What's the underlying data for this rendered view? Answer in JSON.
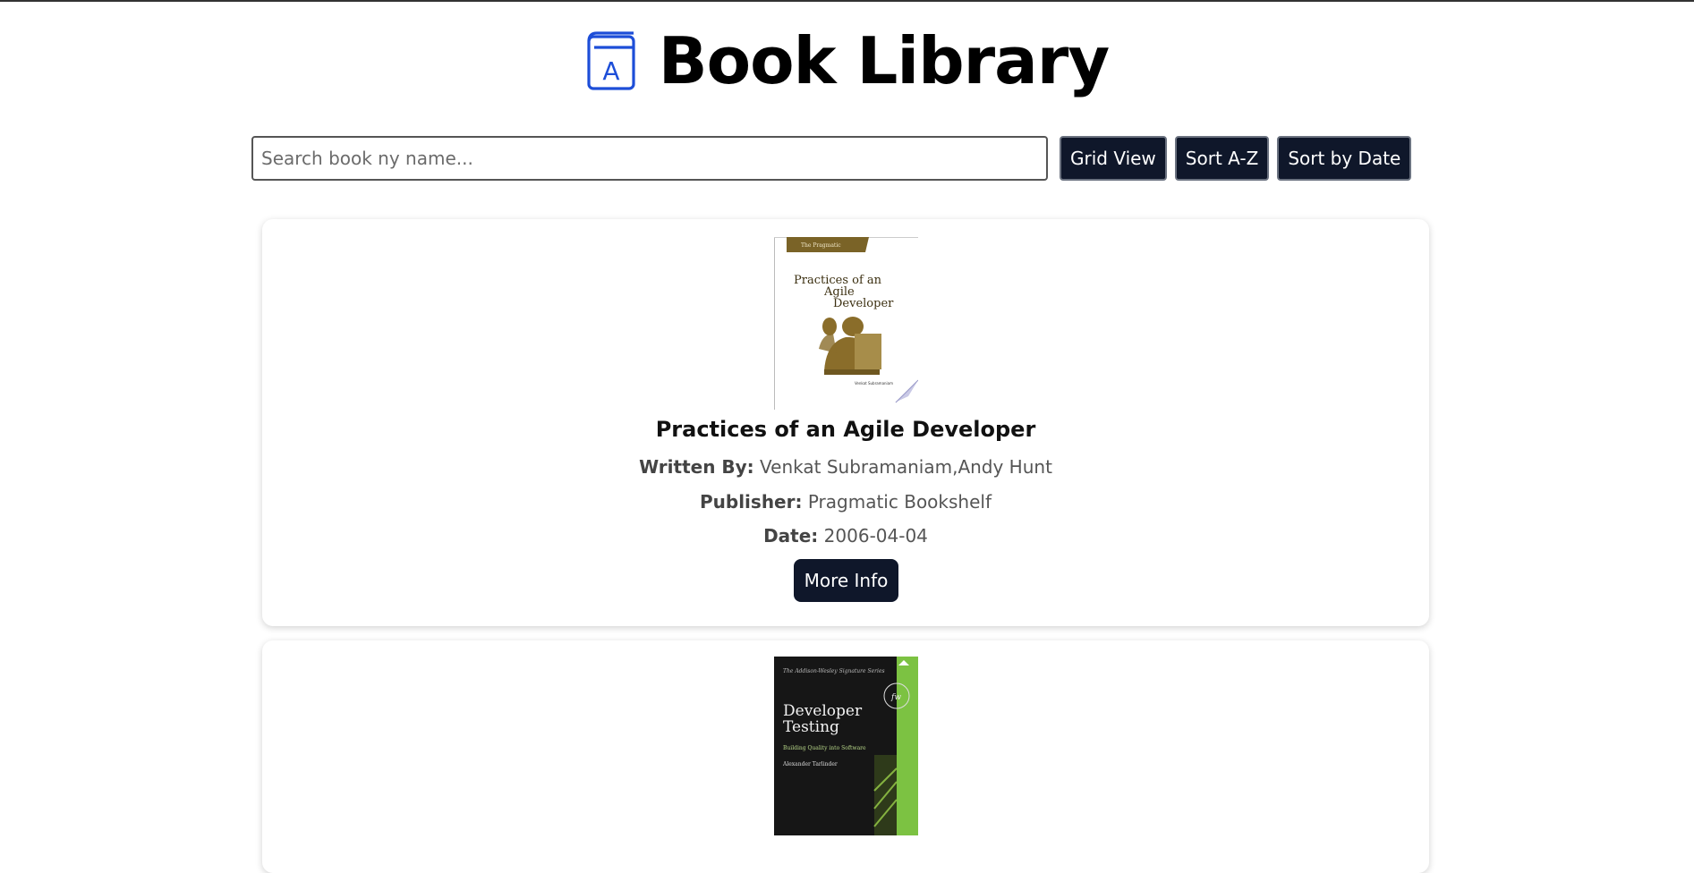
{
  "app": {
    "title": "Book Library",
    "icon": "book-icon",
    "accent_color": "#1d4ed8"
  },
  "toolbar": {
    "search_placeholder": "Search book ny name...",
    "grid_view_label": "Grid View",
    "sort_az_label": "Sort A-Z",
    "sort_date_label": "Sort by Date"
  },
  "books": [
    {
      "title": "Practices of an Agile Developer",
      "written_by_label": "Written By:",
      "authors": "Venkat Subramaniam,Andy Hunt",
      "publisher_label": "Publisher:",
      "publisher": "Pragmatic Bookshelf",
      "date_label": "Date:",
      "date": "2006-04-04",
      "more_info_label": "More Info",
      "cover_text": [
        "Practices of an",
        "Agile",
        "Developer"
      ]
    },
    {
      "title": "Developer Testing",
      "cover_text": [
        "Developer",
        "Testing",
        "Building Quality into Software",
        "Alexander Tarlinder",
        "The Addison-Wesley Signature Series"
      ]
    }
  ]
}
